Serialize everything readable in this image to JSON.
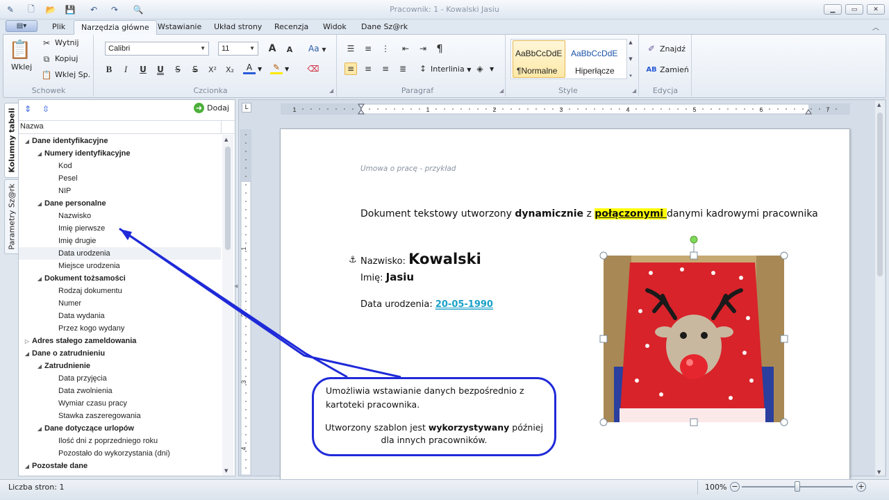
{
  "window": {
    "title": "Pracownik: 1 - Kowalski Jasiu",
    "controls": [
      "minimize",
      "maximize",
      "close"
    ]
  },
  "ribbon_tabs": [
    "Plik",
    "Narzędzia główne",
    "Wstawianie",
    "Układ strony",
    "Recenzja",
    "Widok",
    "Dane Sz@rk"
  ],
  "active_tab": "Narzędzia główne",
  "clipboard": {
    "paste": "Wklej",
    "cut": "Wytnij",
    "copy": "Kopiuj",
    "paste_special": "Wklej Sp.",
    "label": "Schowek"
  },
  "font": {
    "name": "Calibri",
    "size": "11",
    "label": "Czcionka",
    "change_case": "Aa"
  },
  "paragraph": {
    "spacing": "Interlinia",
    "label": "Paragraf"
  },
  "styles": {
    "items": [
      {
        "preview": "AaBbCcDdE",
        "name": "¶Normalne"
      },
      {
        "preview": "AaBbCcDdE",
        "name": "Hiperłącze"
      }
    ],
    "label": "Style"
  },
  "editing": {
    "find": "Znajdź",
    "replace": "Zamień",
    "label": "Edycja"
  },
  "side_tabs": [
    "Kolumny tabeli",
    "Parametry Sz@rk"
  ],
  "tree": {
    "add_button": "Dodaj",
    "column_header": "Nazwa",
    "rows": [
      {
        "level": 0,
        "label": "Dane identyfikacyjne",
        "expanded": true
      },
      {
        "level": 1,
        "label": "Numery identyfikacyjne",
        "expanded": true
      },
      {
        "level": 2,
        "label": "Kod"
      },
      {
        "level": 2,
        "label": "Pesel"
      },
      {
        "level": 2,
        "label": "NIP"
      },
      {
        "level": 1,
        "label": "Dane personalne",
        "expanded": true
      },
      {
        "level": 2,
        "label": "Nazwisko"
      },
      {
        "level": 2,
        "label": "Imię pierwsze"
      },
      {
        "level": 2,
        "label": "Imię drugie"
      },
      {
        "level": 2,
        "label": "Data urodzenia",
        "selected": true
      },
      {
        "level": 2,
        "label": "Miejsce urodzenia"
      },
      {
        "level": 1,
        "label": "Dokument tożsamości",
        "expanded": true
      },
      {
        "level": 2,
        "label": "Rodzaj dokumentu"
      },
      {
        "level": 2,
        "label": "Numer"
      },
      {
        "level": 2,
        "label": "Data wydania"
      },
      {
        "level": 2,
        "label": "Przez kogo wydany"
      },
      {
        "level": 0,
        "label": "Adres stałego zameldowania",
        "expanded": false
      },
      {
        "level": 0,
        "label": "Dane o zatrudnieniu",
        "expanded": true
      },
      {
        "level": 1,
        "label": "Zatrudnienie",
        "expanded": true
      },
      {
        "level": 2,
        "label": "Data przyjęcia"
      },
      {
        "level": 2,
        "label": "Data zwolnienia"
      },
      {
        "level": 2,
        "label": "Wymiar czasu pracy"
      },
      {
        "level": 2,
        "label": "Stawka zaszeregowania"
      },
      {
        "level": 1,
        "label": "Dane dotyczące urlopów",
        "expanded": true
      },
      {
        "level": 2,
        "label": "Ilość dni z poprzedniego roku"
      },
      {
        "level": 2,
        "label": "Pozostało do wykorzystania (dni)"
      },
      {
        "level": 0,
        "label": "Pozostałe dane",
        "expanded": true
      }
    ]
  },
  "ruler": {
    "numbers": [
      "1",
      "1",
      "2",
      "3",
      "4",
      "5",
      "6",
      "7"
    ],
    "vertical_numbers": [
      "1",
      "2",
      "3",
      "4"
    ]
  },
  "document": {
    "header": "Umowa o pracę - przykład",
    "intro_before": "Dokument tekstowy utworzony ",
    "intro_bold": "dynamicznie",
    "intro_mid": " z ",
    "intro_highlight": "połączonymi ",
    "intro_after": "danymi kadrowymi pracownika",
    "surname_label": "Nazwisko: ",
    "surname_value": "Kowalski",
    "name_label": "Imię: ",
    "name_value": "Jasiu",
    "birth_label": "Data urodzenia: ",
    "birth_value": "20-05-1990"
  },
  "callout": {
    "line1": "Umożliwia wstawianie danych bezpośrednio z",
    "line2": "kartoteki pracownika.",
    "line3_before": "Utworzony szablon jest ",
    "line3_bold": "wykorzystywany",
    "line3_after": " później",
    "line4": "dla innych pracowników."
  },
  "status": {
    "pages": "Liczba stron: 1",
    "zoom": "100%",
    "zoom_fraction": 0.5
  },
  "colors": {
    "accent": "#1f2ad8",
    "link": "#1aa0c8",
    "highlight": "#ffff00"
  }
}
